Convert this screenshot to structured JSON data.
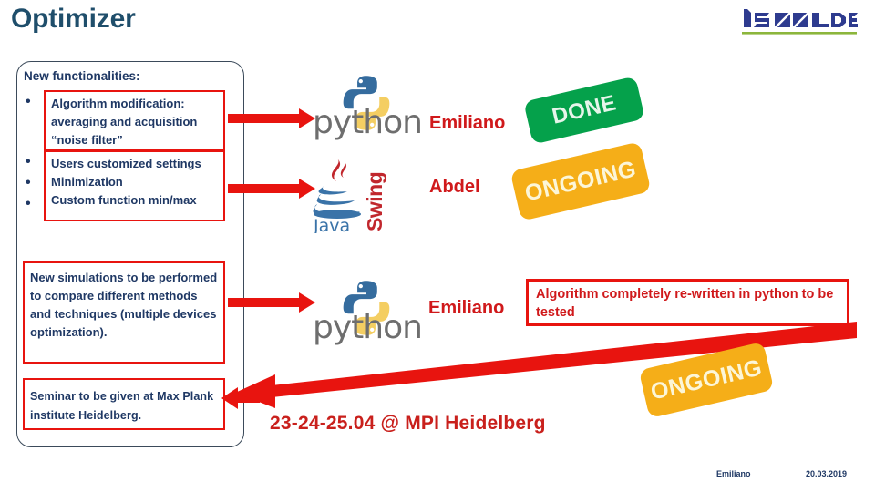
{
  "slide": {
    "title": "Optimizer",
    "title_color": "#1F4E6B",
    "accent_red": "#E8140F",
    "navy": "#1F3864"
  },
  "logo": {
    "name": "isolde-logo",
    "wordmark": "ISOLDE",
    "mark_color": "#2E3B8F",
    "rule_color": "#8CB63C"
  },
  "left_panel": {
    "header": "New functionalities:",
    "bullets": [
      "•",
      "•",
      "•",
      "•"
    ],
    "boxes": [
      {
        "id": "algorithm",
        "text": "Algorithm modification: averaging and acquisition “noise filter”"
      },
      {
        "id": "settings",
        "text": "Users customized settings"
      },
      {
        "id": "minimization",
        "text": "Minimization"
      },
      {
        "id": "custom",
        "text": "Custom function min/max"
      },
      {
        "id": "simulations",
        "text": "New simulations to be performed to compare different methods and techniques (multiple devices optimization)."
      },
      {
        "id": "seminar",
        "text": "Seminar to be given at Max Plank institute Heidelberg."
      }
    ]
  },
  "rows": [
    {
      "technology": "python",
      "owner": "Emiliano",
      "status": "DONE",
      "status_color": "#05A14B"
    },
    {
      "technology": "java-swing",
      "technology_label": "Java",
      "technology_sub_label": "Swing",
      "owner": "Abdel",
      "status": "ONGOING",
      "status_color": "#F5AE18"
    },
    {
      "technology": "python",
      "owner": "Emiliano",
      "status": "ONGOING",
      "status_color": "#F5AE18"
    }
  ],
  "callout": {
    "text": "Algorithm completely re-written in python to be tested",
    "border_color": "#E8140F",
    "text_color": "#D0191B"
  },
  "event": {
    "text": "23-24-25.04  @ MPI Heidelberg",
    "color": "#C9201C"
  },
  "footer": {
    "author": "Emiliano",
    "date": "20.03.2019"
  }
}
